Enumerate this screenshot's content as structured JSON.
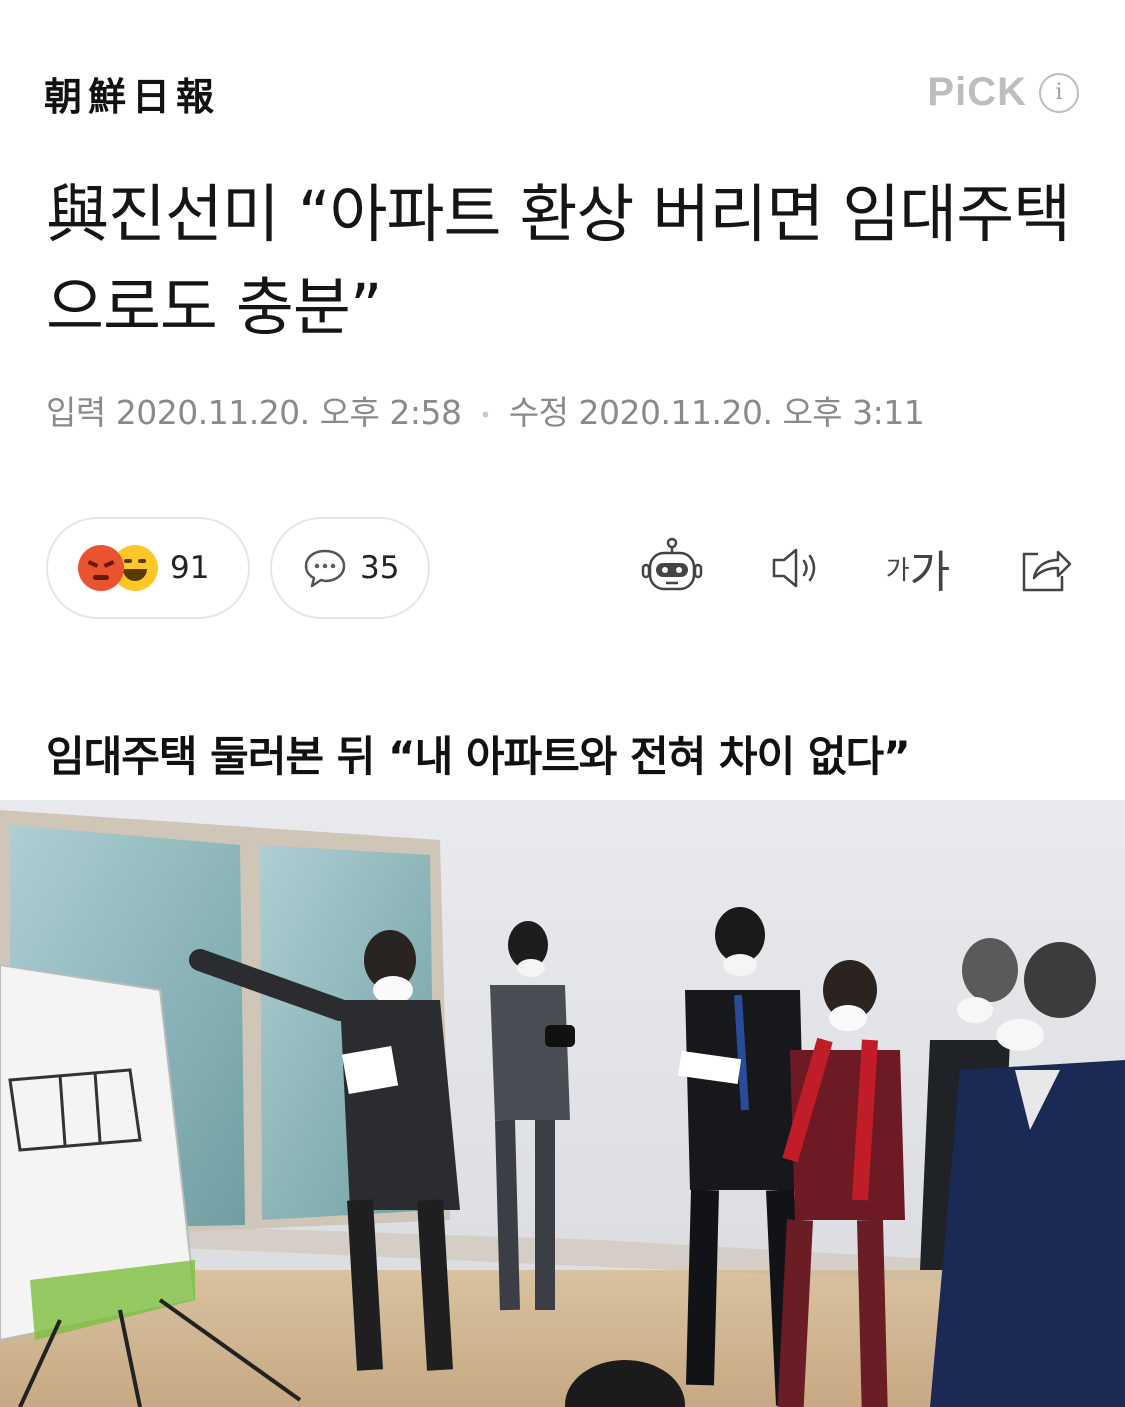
{
  "header": {
    "publisher_logo": "朝鮮日報",
    "pick_label": "PiCK",
    "info_icon": "info-icon"
  },
  "article": {
    "title": "與진선미 “아파트 환상 버리면 임대주택으로도 충분”",
    "dateline": {
      "input_label": "입력",
      "input_time": "2020.11.20. 오후 2:58",
      "separator": "•",
      "edit_label": "수정",
      "edit_time": "2020.11.20. 오후 3:11"
    },
    "subheading": "임대주택 둘러본 뒤 “내 아파트와 전혀 차이 없다”"
  },
  "actions": {
    "reactions_count": "91",
    "comments_count": "35",
    "font_size_small": "가",
    "font_size_big": "가",
    "icons": [
      "angry-emoji-icon",
      "laugh-emoji-icon",
      "comment-icon",
      "robot-summary-icon",
      "speaker-icon",
      "share-icon"
    ]
  },
  "photo": {
    "description_icon": "news-photo"
  },
  "colors": {
    "text": "#151515",
    "meta": "#8a8a8a",
    "pick": "#bdbdbd",
    "border": "#e6e6e6",
    "angry": "#e9532f",
    "laugh": "#ffc62a"
  }
}
